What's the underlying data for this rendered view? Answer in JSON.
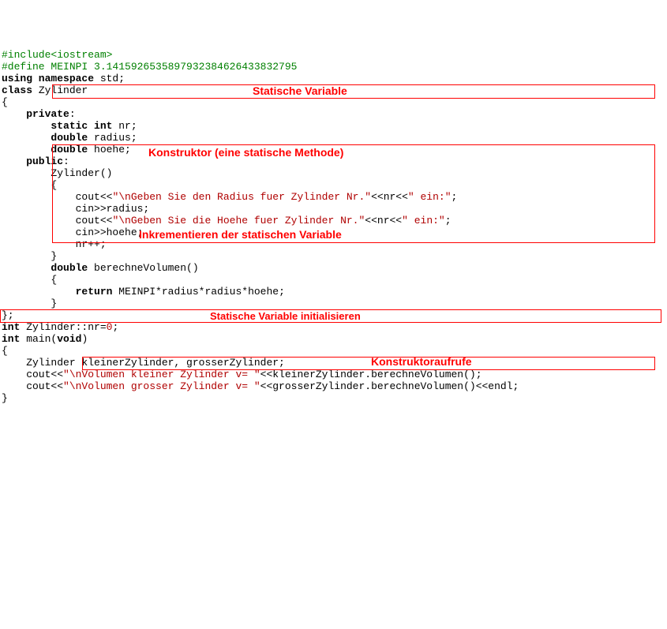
{
  "code": {
    "l1": "#include<iostream>",
    "l2": "#define MEINPI 3.1415926535897932384626433832795",
    "l3a": "using namespace",
    "l3b": " std;",
    "l4a": "class",
    "l4b": " Zylinder",
    "l5": "{",
    "l6a": "    private",
    "l6b": ":",
    "l7a": "        static int",
    "l7b": " nr;",
    "l8a": "        double",
    "l8b": " radius;",
    "l9a": "        double",
    "l9b": " hoehe;",
    "l10a": "    public",
    "l10b": ":",
    "l11": "        Zylinder()",
    "l12": "        {",
    "l13a": "            cout<<",
    "l13b": "\"\\nGeben Sie den Radius fuer Zylinder Nr.\"",
    "l13c": "<<nr<<",
    "l13d": "\" ein:\"",
    "l13e": ";",
    "l14": "            cin>>radius;",
    "l15a": "            cout<<",
    "l15b": "\"\\nGeben Sie die Hoehe fuer Zylinder Nr.\"",
    "l15c": "<<nr<<",
    "l15d": "\" ein:\"",
    "l15e": ";",
    "l16": "            cin>>hoehe;",
    "l17": "            nr++;",
    "l18": "        }",
    "l19a": "        double",
    "l19b": " berechneVolumen()",
    "l20": "        {",
    "l21a": "            return",
    "l21b": " MEINPI*radius*radius*hoehe;",
    "l22": "        }",
    "l23": "};",
    "l24a": "int",
    "l24b": " Zylinder::nr=",
    "l24c": "0",
    "l24d": ";",
    "l25a": "int",
    "l25b": " main(",
    "l25c": "void",
    "l25d": ")",
    "l26": "{",
    "l27": "    Zylinder kleinerZylinder, grosserZylinder;",
    "l28a": "    cout<<",
    "l28b": "\"\\nVolumen kleiner Zylinder v= \"",
    "l28c": "<<kleinerZylinder.berechneVolumen();",
    "l29a": "    cout<<",
    "l29b": "\"\\nVolumen grosser Zylinder v= \"",
    "l29c": "<<grosserZylinder.berechneVolumen()<<endl;",
    "l30": "}"
  },
  "labels": {
    "static_var": "Statische Variable",
    "constructor": "Konstruktor (eine statische Methode)",
    "increment": "Inkrementieren der statischen Variable",
    "init_static": "Statische Variable initialisieren",
    "ctor_calls": "Konstruktoraufrufe"
  }
}
